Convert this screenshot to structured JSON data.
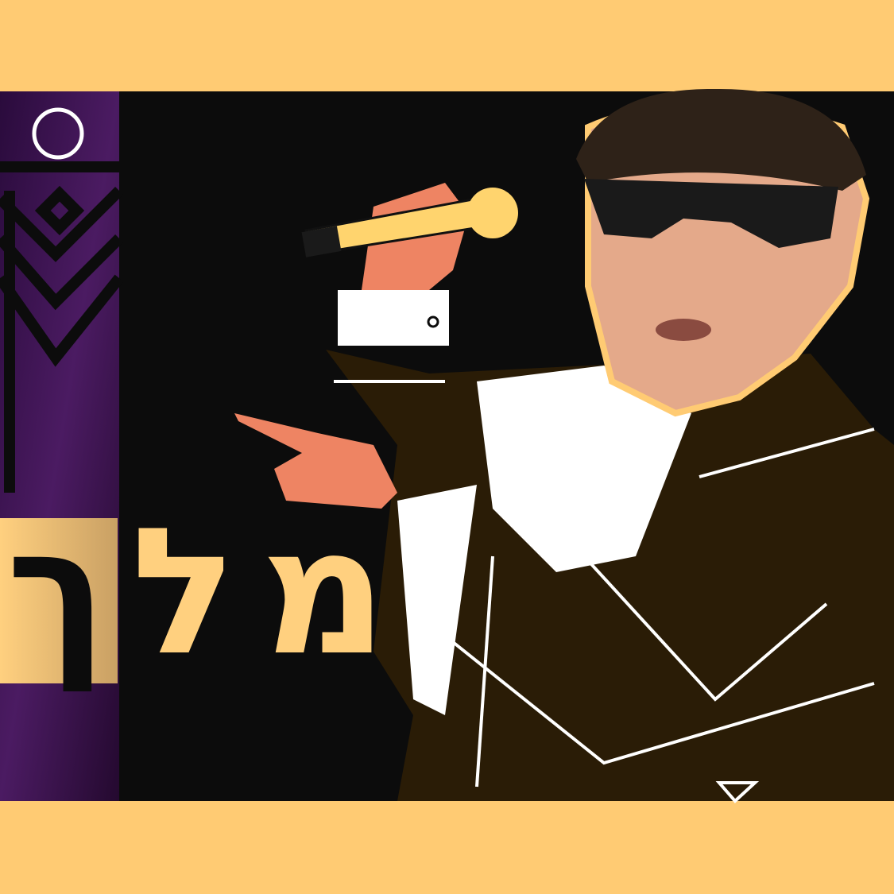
{
  "title": {
    "word": "מלך",
    "main_letters": "מל",
    "final_letter": "ך"
  },
  "colors": {
    "frame": "#FFCB73",
    "background": "#0C0C0C",
    "side_strip": "#3A1450",
    "title": "#FFD07F",
    "suit": "#2A1C06",
    "skin_illustration": "#EE8463",
    "microphone": "#FFD46E"
  },
  "icons": [
    "circle-outline-icon",
    "microphone-icon",
    "pointing-hand-icon",
    "sunglasses-icon"
  ]
}
